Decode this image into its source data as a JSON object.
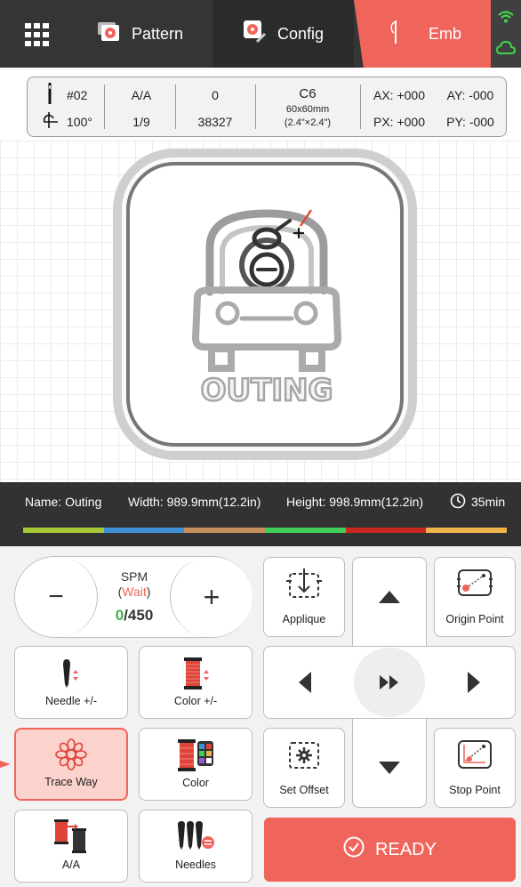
{
  "nav": {
    "tabs": [
      {
        "label": "Pattern",
        "icon": "flower-icon"
      },
      {
        "label": "Config",
        "icon": "flower-gear-icon"
      },
      {
        "label": "Emb",
        "icon": "needle-icon"
      }
    ],
    "active_tab": "Emb",
    "accent": "#f0655b",
    "status_icons": [
      "wifi-icon",
      "cloud-icon"
    ]
  },
  "info": {
    "needle": "#02",
    "angle": "100°",
    "thread_mode": "A/A",
    "color_step": "1/9",
    "stitch": "0",
    "total_stitch": "38327",
    "hoop": "C6",
    "hoop_size_mm": "60x60mm",
    "hoop_size_in": "(2.4\"×2.4\")",
    "ax": "AX: +000",
    "ay": "AY: -000",
    "px": "PX: +000",
    "py": "PY: -000"
  },
  "design": {
    "text": "OUTING"
  },
  "strip": {
    "name": "Name: Outing",
    "width": "Width: 989.9mm(12.2in)",
    "height": "Height: 998.9mm(12.2in)",
    "time": "35min",
    "colors": [
      "#a6c837",
      "#3d8fd6",
      "#c6915c",
      "#3fcc5a",
      "#c8281e",
      "#eeb44a"
    ]
  },
  "spm": {
    "title": "SPM",
    "state": "Wait",
    "current": "0",
    "sep": "/",
    "max": "450",
    "minus": "−",
    "plus": "+"
  },
  "buttons": {
    "applique": "Applique",
    "origin_point": "Origin Point",
    "needle_adj": "Needle +/-",
    "color_adj": "Color +/-",
    "trace_way": "Trace Way",
    "color": "Color",
    "set_offset": "Set Offset",
    "stop_point": "Stop Point",
    "aa": "A/A",
    "needles": "Needles",
    "ready": "READY"
  }
}
